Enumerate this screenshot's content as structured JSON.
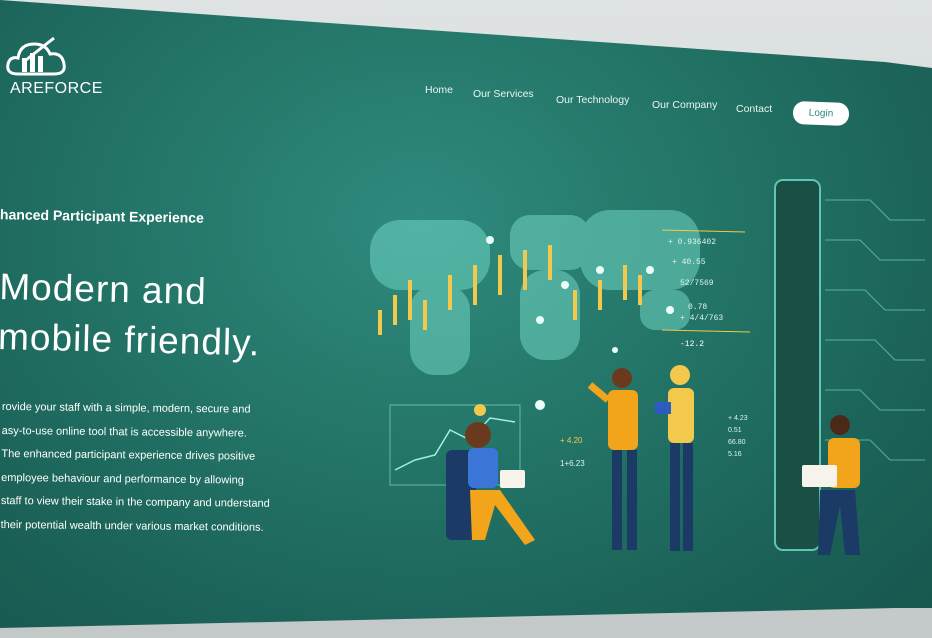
{
  "brand": {
    "name": "AREFORCE",
    "logo_icon": "cloud-chart-icon"
  },
  "nav": {
    "items": [
      "Home",
      "Our Services",
      "Our Technology",
      "Our Company",
      "Contact"
    ],
    "login_label": "Login"
  },
  "hero": {
    "subheading": "hanced Participant Experience",
    "headline_line1": "Modern and",
    "headline_line2": "mobile friendly.",
    "body": "rovide your staff with a simple, modern, secure and\nasy-to-use online tool that is accessible anywhere.\nThe enhanced participant experience drives positive\nemployee behaviour and performance by allowing\nstaff to view their stake in the company and understand\ntheir potential wealth under various market conditions."
  },
  "illustration": {
    "ticker_values": [
      "+ 0.936402",
      "+ 40.55",
      "52/7569",
      "0.78",
      "+ 4/4/763",
      "-12.2"
    ],
    "chart_labels": [
      "+ 4.20",
      "1+6.23"
    ],
    "small_values": [
      "+ 4.23",
      "0.51",
      "66.80",
      "5.16"
    ]
  },
  "colors": {
    "background": "#237567",
    "accent": "#f2a51a",
    "login_text": "#2c8a7c"
  }
}
